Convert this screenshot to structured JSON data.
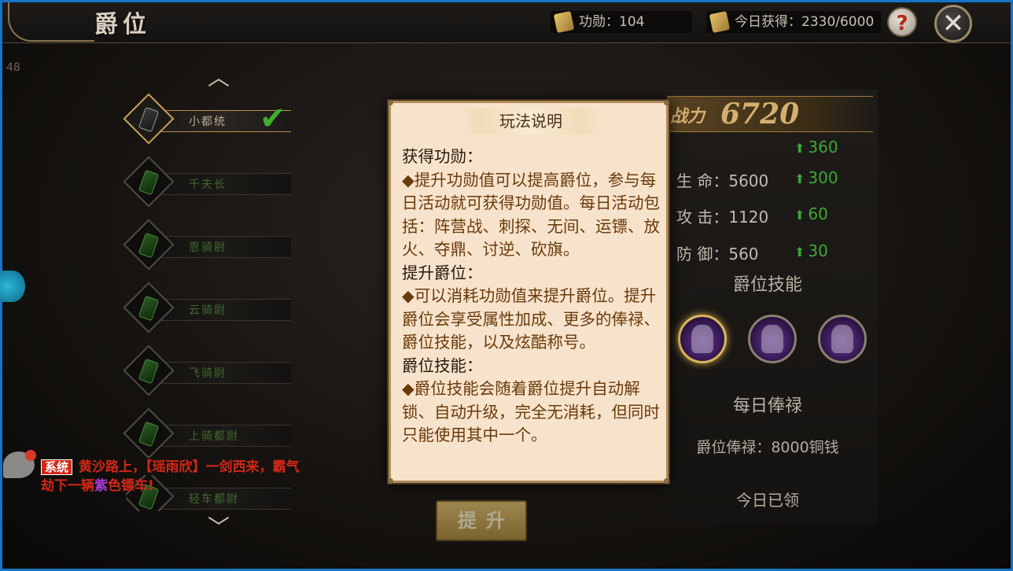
{
  "header": {
    "title": "爵位",
    "merit_label": "功勋：104",
    "today_label": "今日获得：2330/6000",
    "help_glyph": "?",
    "close_glyph": "✕"
  },
  "ranks": [
    {
      "label": "小都统",
      "active": true
    },
    {
      "label": "千夫长",
      "active": false
    },
    {
      "label": "恩骑尉",
      "active": false
    },
    {
      "label": "云骑尉",
      "active": false
    },
    {
      "label": "飞骑尉",
      "active": false
    },
    {
      "label": "上骑都尉",
      "active": false
    },
    {
      "label": "轻车都尉",
      "active": false
    }
  ],
  "stats": {
    "power_label": "战力",
    "power_value": "6720",
    "rows": [
      {
        "label": "",
        "value": "",
        "inc": "360"
      },
      {
        "label": "生 命：5600",
        "inc": "300"
      },
      {
        "label": "攻 击：1120",
        "inc": "60"
      },
      {
        "label": "防 御：560",
        "inc": "30"
      }
    ],
    "skills_title": "爵位技能",
    "salary_title": "每日俸禄",
    "salary_text": "爵位俸禄：8000铜钱",
    "claimed_text": "今日已领"
  },
  "promote_button": "提升",
  "chat": {
    "tag": "系统",
    "text_before": "黄沙路上，【瑶雨欣】一剑西来，霸气劫下一辆",
    "text_purple": "紫",
    "text_after": "色镖车!"
  },
  "modal": {
    "title": "玩法说明",
    "sections": [
      {
        "heading": "获得功勋：",
        "body": "◆提升功勋值可以提高爵位，参与每日活动就可获得功勋值。每日活动包括：阵营战、刺探、无间、运镖、放火、夺鼎、讨逆、砍旗。"
      },
      {
        "heading": "提升爵位：",
        "body": "◆可以消耗功勋值来提升爵位。提升爵位会享受属性加成、更多的俸禄、爵位技能，以及炫酷称号。"
      },
      {
        "heading": "爵位技能：",
        "body": "◆爵位技能会随着爵位提升自动解锁、自动升级，完全无消耗，但同时只能使用其中一个。"
      }
    ]
  },
  "colors": {
    "accent_gold": "#d4b070",
    "stat_green": "#3aa838",
    "modal_bg": "#f7e3cc",
    "modal_text": "#6a3a0a",
    "frame_border": "#1673c6"
  },
  "icons": [
    "scroll-icon",
    "help-icon",
    "close-icon",
    "arrow-up-icon",
    "arrow-down-icon",
    "checkmark-icon",
    "chat-icon",
    "skill-icon"
  ]
}
